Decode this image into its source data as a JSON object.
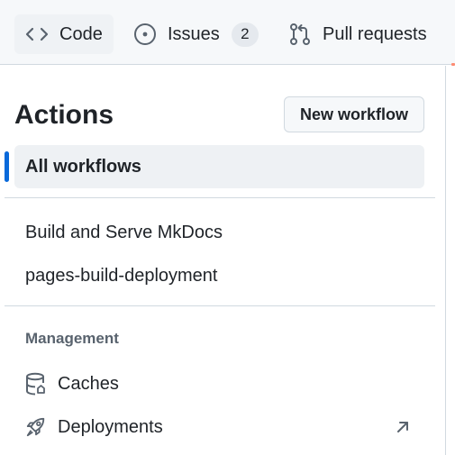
{
  "repo_nav": {
    "tabs": [
      {
        "label": "Code",
        "icon": "code-icon"
      },
      {
        "label": "Issues",
        "icon": "issue-opened-icon",
        "counter": "2"
      },
      {
        "label": "Pull requests",
        "icon": "git-pull-request-icon"
      }
    ],
    "accent_color": "#fd8c73"
  },
  "sidebar": {
    "title": "Actions",
    "new_workflow_label": "New workflow",
    "all_workflows_label": "All workflows",
    "active_indicator_color": "#0969da",
    "workflows": [
      {
        "label": "Build and Serve MkDocs"
      },
      {
        "label": "pages-build-deployment"
      }
    ],
    "management": {
      "heading": "Management",
      "items": [
        {
          "label": "Caches",
          "icon": "database-icon"
        },
        {
          "label": "Deployments",
          "icon": "rocket-icon",
          "external_icon": "arrow-up-right-icon"
        }
      ]
    }
  }
}
